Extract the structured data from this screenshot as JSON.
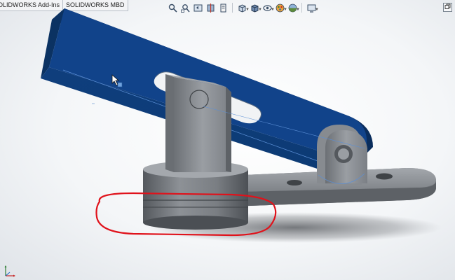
{
  "tabs": [
    {
      "label": "OLIDWORKS Add-Ins"
    },
    {
      "label": "SOLIDWORKS MBD"
    }
  ],
  "hud_toolbar": {
    "buttons": [
      {
        "name": "zoom-to-fit-icon",
        "glyph": "⌕"
      },
      {
        "name": "zoom-to-area-icon",
        "glyph": "⚲"
      },
      {
        "name": "previous-view-icon",
        "glyph": "↶"
      },
      {
        "name": "section-view-icon",
        "glyph": "▥"
      },
      {
        "name": "dynamic-annotation-icon",
        "glyph": "⌖"
      },
      {
        "name": "view-orientation-icon",
        "glyph": "⬚",
        "dropdown": true
      },
      {
        "name": "display-style-icon",
        "glyph": "◧",
        "dropdown": true
      },
      {
        "name": "hide-show-items-icon",
        "glyph": "◈",
        "dropdown": true
      },
      {
        "name": "edit-appearance-icon",
        "glyph": "◉",
        "dropdown": true
      },
      {
        "name": "apply-scene-icon",
        "glyph": "◐",
        "dropdown": true
      },
      {
        "name": "view-settings-icon",
        "glyph": "▭",
        "dropdown": true
      }
    ]
  },
  "colors": {
    "arm_blue": "#0f3f7f",
    "arm_blue_dark": "#0a2d5c",
    "steel": "#8a8d92",
    "steel_dark": "#5f6368",
    "steel_light": "#b6b9be",
    "highlight_red": "#e0121b",
    "edge_line": "#5b8fd6"
  }
}
